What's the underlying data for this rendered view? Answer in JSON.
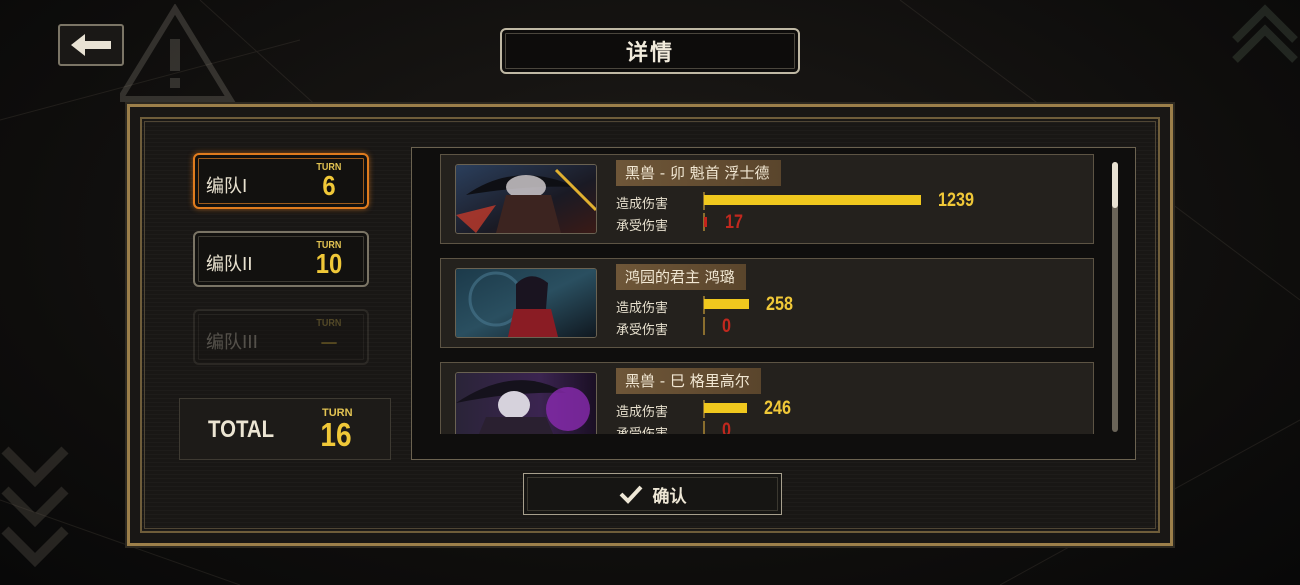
{
  "header": {
    "title": "详情"
  },
  "teams": [
    {
      "label": "编队I",
      "turn_caption": "TURN",
      "turn": "6",
      "state": "active"
    },
    {
      "label": "编队II",
      "turn_caption": "TURN",
      "turn": "10",
      "state": "normal"
    },
    {
      "label": "编队III",
      "turn_caption": "TURN",
      "turn": "—",
      "state": "disabled"
    }
  ],
  "total": {
    "label": "TOTAL",
    "turn_caption": "TURN",
    "turn": "16"
  },
  "stats": {
    "dealt_label": "造成伤害",
    "taken_label": "承受伤害",
    "max_dealt": 1239
  },
  "units": [
    {
      "name": "黑兽 - 卯 魁首 浮士德",
      "dealt": 1239,
      "taken": 17
    },
    {
      "name": "鸿园的君主 鸿璐",
      "dealt": 258,
      "taken": 0
    },
    {
      "name": "黑兽 - 巳 格里高尔",
      "dealt": 246,
      "taken": 0
    }
  ],
  "footer": {
    "confirm_label": "确认"
  },
  "colors": {
    "accent_orange": "#e07c1e",
    "turn_yellow": "#f0c838",
    "damage_bar": "#f0c81e",
    "taken_red": "#c4241c"
  }
}
